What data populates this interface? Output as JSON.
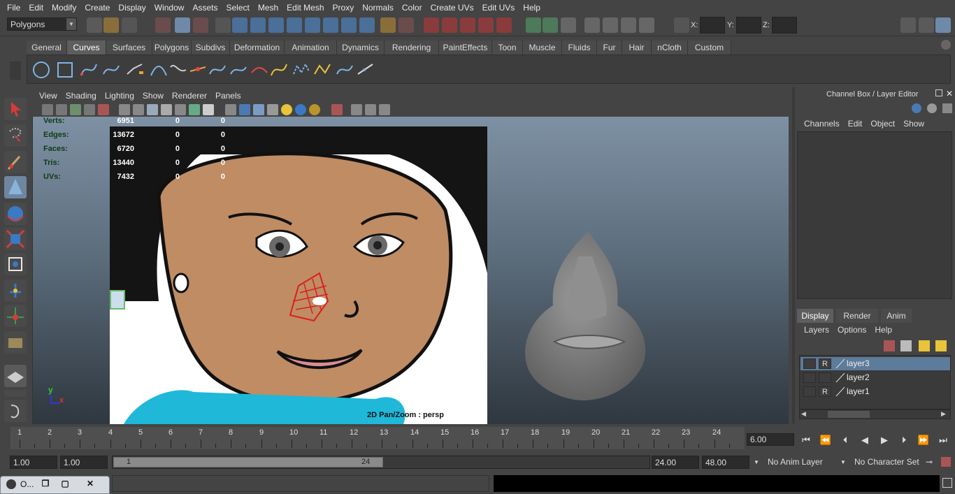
{
  "menubar": [
    "File",
    "Edit",
    "Modify",
    "Create",
    "Display",
    "Window",
    "Assets",
    "Select",
    "Mesh",
    "Edit Mesh",
    "Proxy",
    "Normals",
    "Color",
    "Create UVs",
    "Edit UVs",
    "Help"
  ],
  "statusline": {
    "mode": "Polygons",
    "x_label": "X:",
    "y_label": "Y:",
    "z_label": "Z:"
  },
  "shelf": {
    "tabs": [
      "General",
      "Curves",
      "Surfaces",
      "Polygons",
      "Subdivs",
      "Deformation",
      "Animation",
      "Dynamics",
      "Rendering",
      "PaintEffects",
      "Toon",
      "Muscle",
      "Fluids",
      "Fur",
      "Hair",
      "nCloth",
      "Custom"
    ],
    "active": "Curves"
  },
  "viewport": {
    "menu": [
      "View",
      "Shading",
      "Lighting",
      "Show",
      "Renderer",
      "Panels"
    ],
    "hud": [
      {
        "label": "Verts:",
        "v1": "6951",
        "v2": "0",
        "v3": "0"
      },
      {
        "label": "Edges:",
        "v1": "13672",
        "v2": "0",
        "v3": "0"
      },
      {
        "label": "Faces:",
        "v1": "6720",
        "v2": "0",
        "v3": "0"
      },
      {
        "label": "Tris:",
        "v1": "13440",
        "v2": "0",
        "v3": "0"
      },
      {
        "label": "UVs:",
        "v1": "7432",
        "v2": "0",
        "v3": "0"
      }
    ],
    "camera": "2D Pan/Zoom : persp",
    "axis_y": "y",
    "axis_x": "x"
  },
  "channelbox": {
    "title": "Channel Box / Layer Editor",
    "menu": [
      "Channels",
      "Edit",
      "Object",
      "Show"
    ]
  },
  "layereditor": {
    "tabs": [
      "Display",
      "Render",
      "Anim"
    ],
    "menu": [
      "Layers",
      "Options",
      "Help"
    ],
    "layers": [
      {
        "name": "layer3",
        "v": "",
        "r": "R",
        "selected": true
      },
      {
        "name": "layer2",
        "v": "",
        "r": "",
        "selected": false
      },
      {
        "name": "layer1",
        "v": "",
        "r": "R",
        "selected": false
      }
    ]
  },
  "timeslider": {
    "ticks": [
      "1",
      "2",
      "3",
      "4",
      "5",
      "6",
      "7",
      "8",
      "9",
      "10",
      "11",
      "12",
      "13",
      "14",
      "15",
      "16",
      "17",
      "18",
      "19",
      "20",
      "21",
      "22",
      "23",
      "24"
    ],
    "current": "6.00"
  },
  "rangeslider": {
    "start": "1.00",
    "start2": "1.00",
    "inner_start": "1",
    "inner_end": "24",
    "end": "24.00",
    "end2": "48.00",
    "anim_layer": "No Anim Layer",
    "char_set": "No Character Set"
  },
  "minimized": {
    "title": "O..."
  },
  "colors": {
    "bg": "#444444",
    "selected_layer": "#5d7b9b",
    "hud_label": "#0d3b17"
  }
}
